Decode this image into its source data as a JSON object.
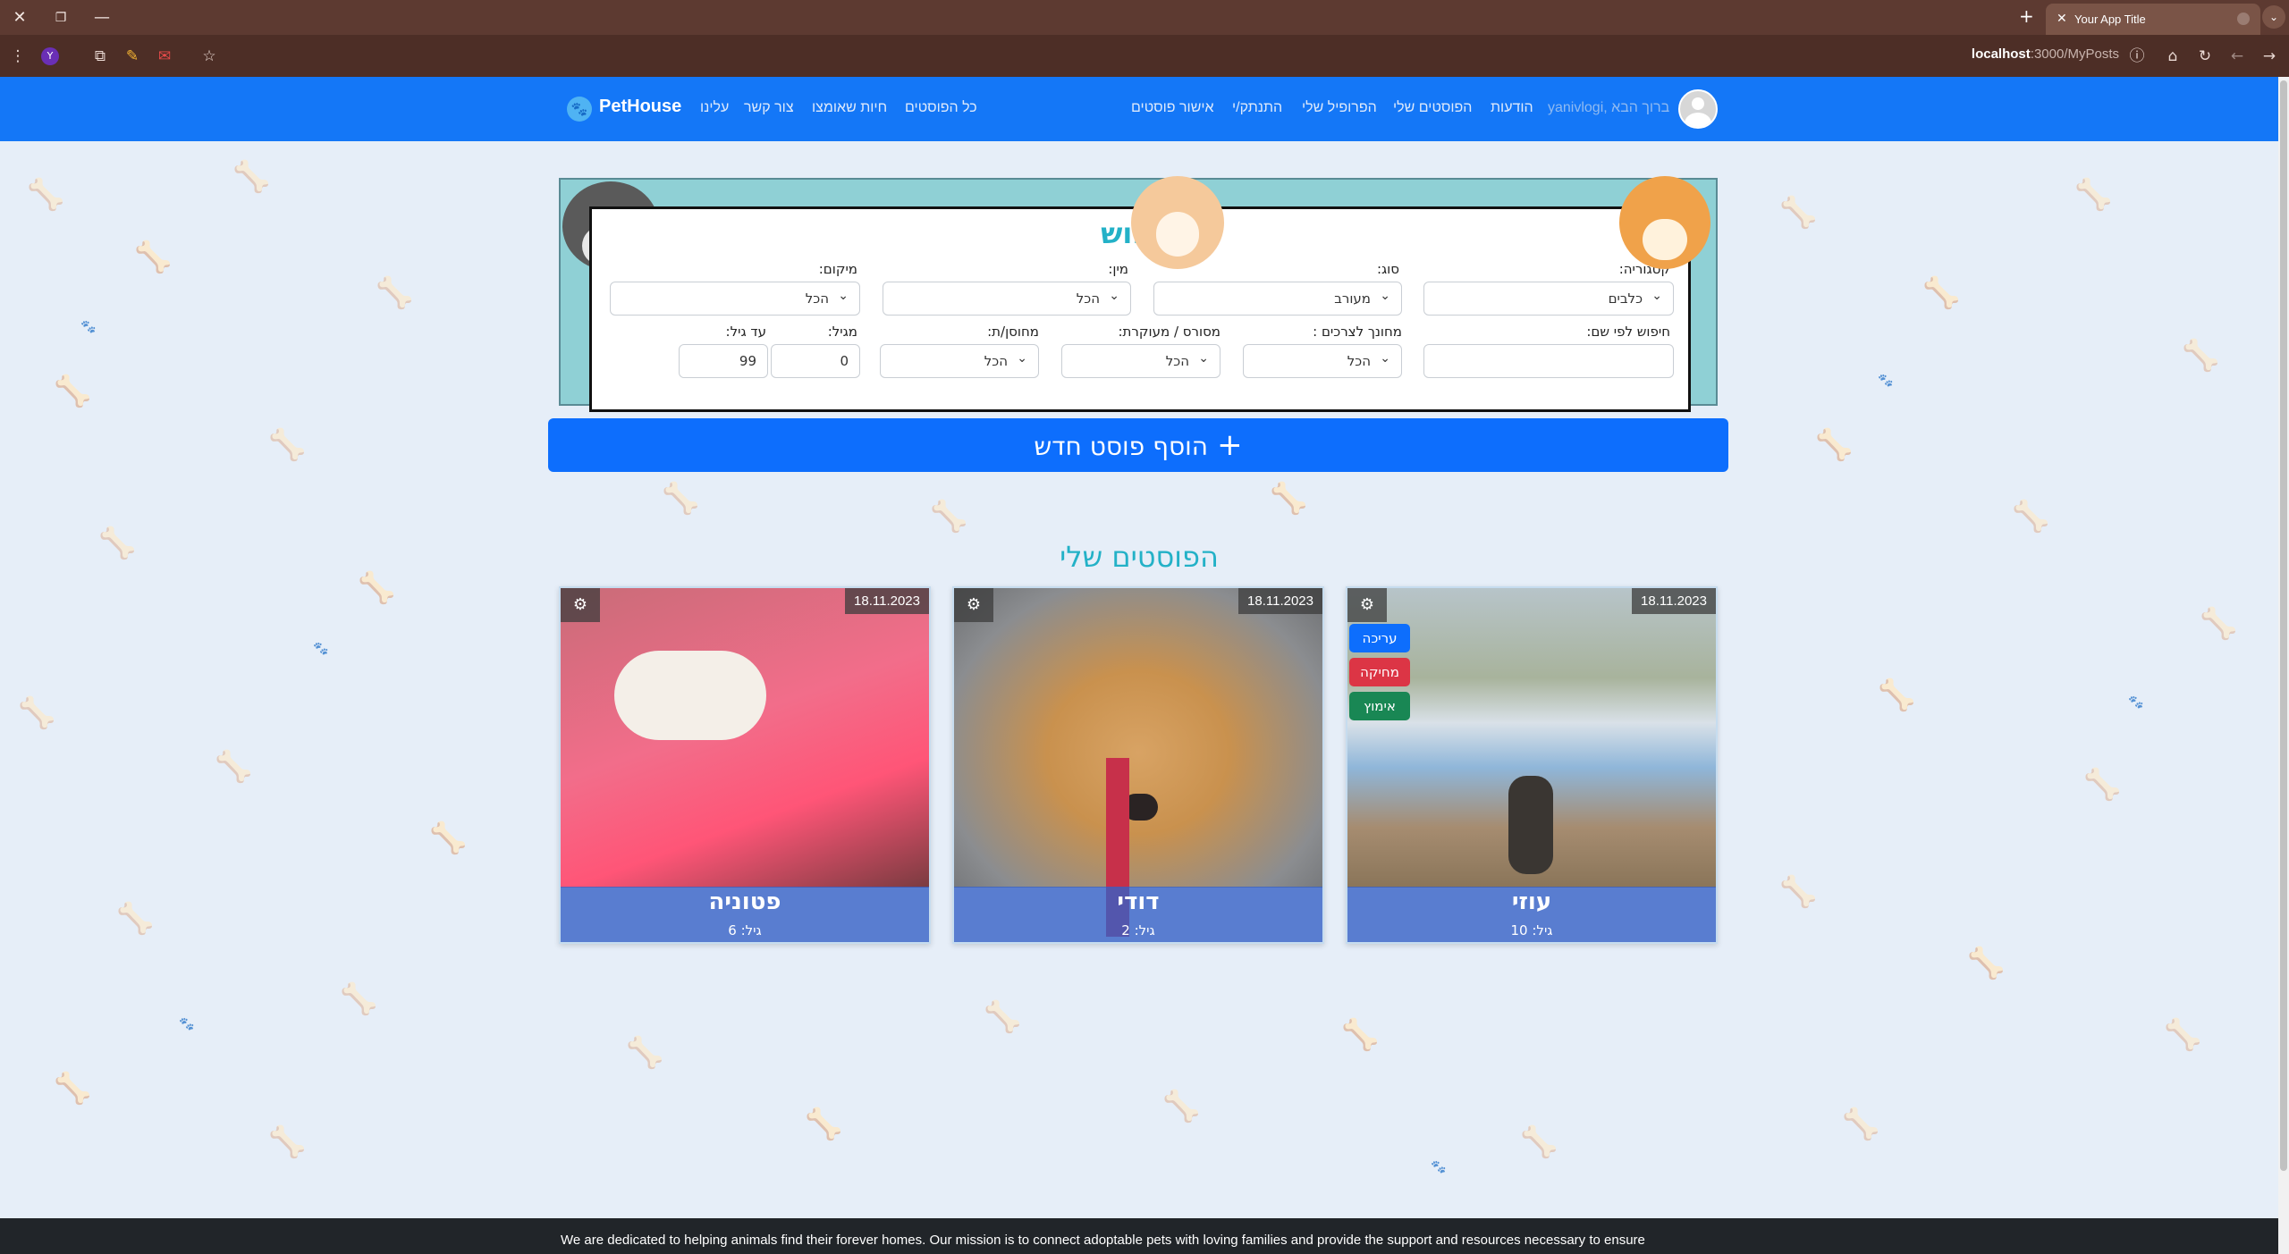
{
  "browser": {
    "tab_title": "Your App Title",
    "url_host": "localhost",
    "url_path": ":3000/MyPosts"
  },
  "nav": {
    "brand": "PetHouse",
    "links": [
      "כל הפוסטים",
      "חיות שאומצו",
      "צור קשר",
      "עלינו"
    ],
    "right_links": [
      "אישור פוסטים",
      "התנתק/י",
      "הפרופיל שלי",
      "הפוסטים שלי",
      "הודעות"
    ],
    "greeting": "yanivlogi, ברוך הבא"
  },
  "search": {
    "title": "חיפוש",
    "category_label": "קטגוריה:",
    "category_value": "כלבים",
    "type_label": "סוג:",
    "type_value": "מעורב",
    "gender_label": "מין:",
    "gender_value": "הכל",
    "location_label": "מיקום:",
    "location_value": "הכל",
    "name_label": "חיפוש לפי שם:",
    "name_value": "",
    "kids_label": "מחונך לצרכים :",
    "kids_value": "הכל",
    "neutered_label": "מסורס / מעוקרת:",
    "neutered_value": "הכל",
    "vaccinated_label": "מחוסן/ת:",
    "vaccinated_value": "הכל",
    "age_from_label": "מגיל:",
    "age_from_value": "0",
    "age_to_label": "עד גיל:",
    "age_to_value": "99"
  },
  "add_post_label": "הוסף פוסט חדש",
  "posts_title": "הפוסטים שלי",
  "cards": [
    {
      "name": "פטוניה",
      "age": "גיל: 6",
      "date": "18.11.2023"
    },
    {
      "name": "דודי",
      "age": "גיל: 2",
      "date": "18.11.2023"
    },
    {
      "name": "עוזי",
      "age": "גיל: 10",
      "date": "18.11.2023"
    }
  ],
  "card_menu": {
    "edit": "עריכה",
    "delete": "מחיקה",
    "adopt": "אימוץ"
  },
  "footer_text": "We are dedicated to helping animals find their forever homes. Our mission is to connect adoptable pets with loving families and provide the support and resources necessary to ensure",
  "colors": {
    "navbar": "#1477f7",
    "primary_button": "#0d6efd",
    "title_teal": "#23b1c7",
    "delete_red": "#dc3545",
    "adopt_green": "#198754"
  },
  "icons": [
    "close-icon",
    "restore-icon",
    "minimize-icon",
    "plus-icon",
    "gear-icon",
    "chevron-down-icon",
    "home-icon",
    "reload-icon",
    "back-icon",
    "forward-icon",
    "star-icon"
  ]
}
